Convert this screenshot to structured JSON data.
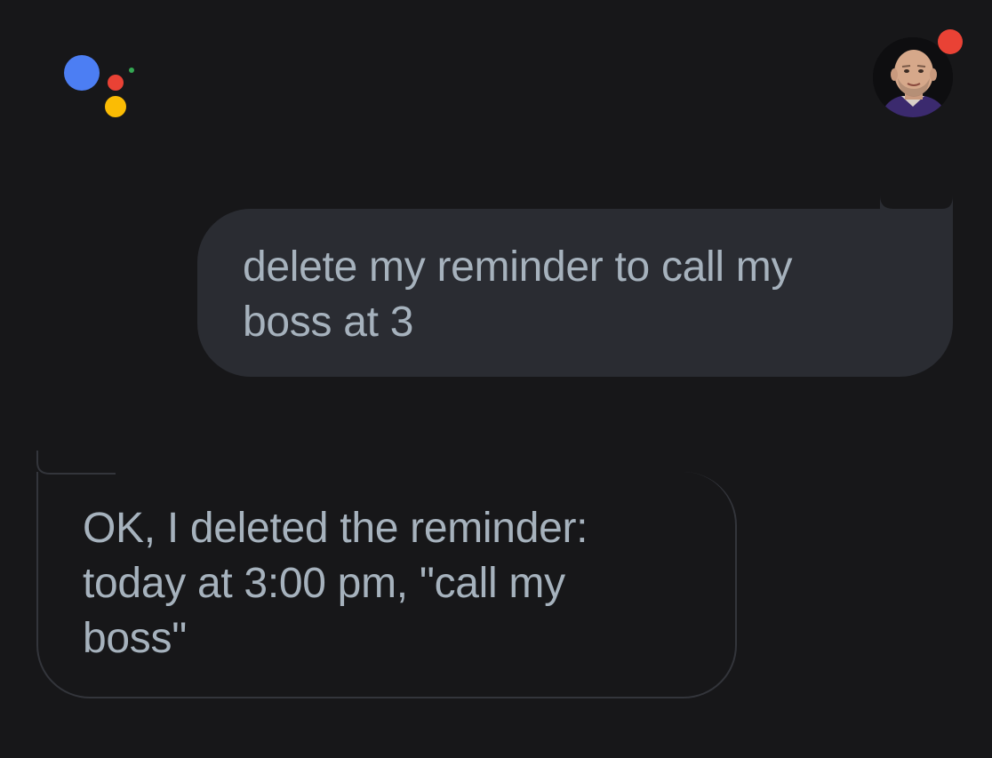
{
  "colors": {
    "background": "#171719",
    "user_bubble_bg": "#2a2c32",
    "assistant_bubble_border": "#33353b",
    "text": "#a6b2bd",
    "logo_blue": "#4c7ef3",
    "logo_red": "#e94235",
    "logo_yellow": "#fbbc04",
    "logo_green": "#34a853",
    "notification_red": "#e94235"
  },
  "header": {
    "assistant_logo": "google-assistant-logo",
    "avatar": "user-profile-avatar"
  },
  "conversation": {
    "user_message": {
      "line1": "delete my reminder to call my",
      "line2": "boss at 3"
    },
    "assistant_message": {
      "line1": "OK, I deleted the reminder:",
      "line2": "today at 3:00 pm, \"call my",
      "line3": "boss\""
    }
  }
}
